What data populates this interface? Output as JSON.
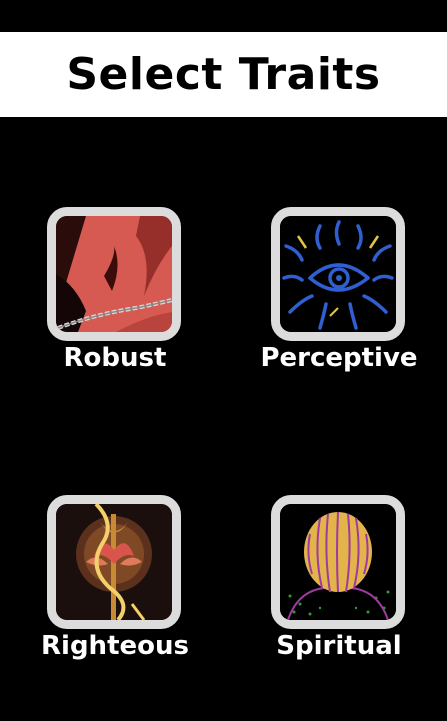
{
  "header": {
    "title": "Select Traits",
    "background_color": "#ffffff",
    "text_color": "#000000"
  },
  "page": {
    "background_color": "#000000"
  },
  "traits": [
    {
      "label": "Robust",
      "image": "red-torso-chain-artwork"
    },
    {
      "label": "Perceptive",
      "image": "blue-eye-artwork"
    },
    {
      "label": "Righteous",
      "image": "lotus-trident-artwork"
    },
    {
      "label": "Spiritual",
      "image": "golden-head-artwork"
    }
  ],
  "colors": {
    "frame": "#dcdcdc",
    "label": "#ffffff"
  }
}
